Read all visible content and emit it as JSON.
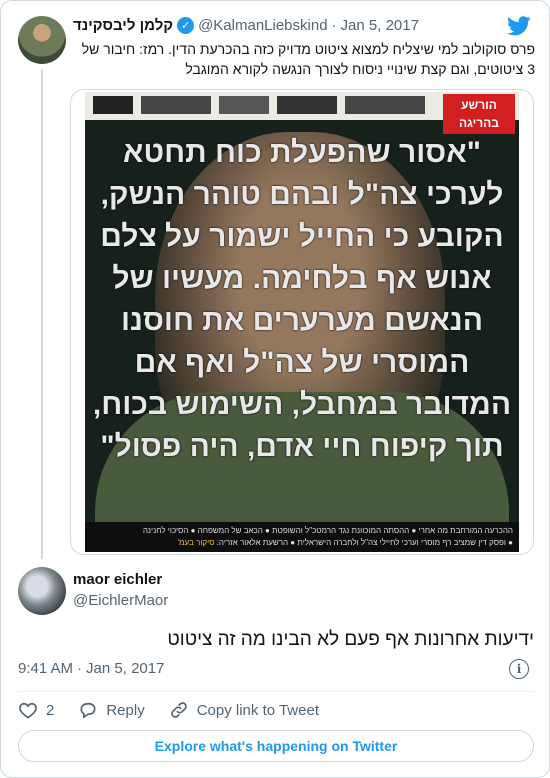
{
  "quoted_tweet": {
    "display_name": "קלמן ליבסקינד",
    "handle": "@KalmanLiebskind",
    "separator": "·",
    "date": "Jan 5, 2017",
    "text": "פרס סוקולוב למי שיצליח למצוא ציטוט מדויק כזה בהכרעת הדין. רמז: חיבור של 3 ציטוטים, וגם קצת שינויי ניסוח לצורך הנגשה לקורא המוגבל",
    "media": {
      "badge_text": "הורשע בהריגה",
      "quote_text": "\"אסור שהפעלת כוח תחטא לערכי צה\"ל ובהם טוהר הנשק, הקובע כי החייל ישמור על צלם אנוש אף בלחימה. מעשיו של הנאשם מערערים את חוסנו המוסרי של צה\"ל ואף אם המדובר במחבל, השימוש בכוח, תוך קיפוח חיי אדם, היה פסול\"",
      "bottom_strip_1": "ההכרעה המורחבת מה אחרי ● ההסתה המוכוונת נגד הרמטכ\"ל והשופטת ● הכאב של המשפחה ● הסיכוי לחנינה",
      "bottom_strip_2": "● ופסק דין שמציב רף מוסרי וערכי לחיילי צה\"ל ולחברה הישראלית ● הרשעת אלאור אזריה:",
      "bottom_strip_highlight": "סיקור בעמ'",
      "colors": {
        "badge": "#d21f1f",
        "background": "#16211c"
      }
    }
  },
  "tweet": {
    "display_name": "maor eichler",
    "handle": "@EichlerMaor",
    "text": "ידיעות אחרונות אף פעם לא הבינו מה זה ציטוט",
    "time": "9:41 AM",
    "separator": "·",
    "date": "Jan 5, 2017",
    "likes_count": "2",
    "reply_label": "Reply",
    "copy_link_label": "Copy link to Tweet"
  },
  "footer": {
    "explore_label": "Explore what's happening on Twitter"
  },
  "icons": {
    "brand": "twitter-bird-icon",
    "verified": "verified-badge-icon",
    "info": "info-icon",
    "like": "heart-icon",
    "reply": "reply-bubble-icon",
    "copy_link": "link-icon"
  },
  "colors": {
    "accent": "#1d9bf0",
    "text": "#0f1419",
    "secondary": "#536471",
    "border": "#cfd9de"
  }
}
